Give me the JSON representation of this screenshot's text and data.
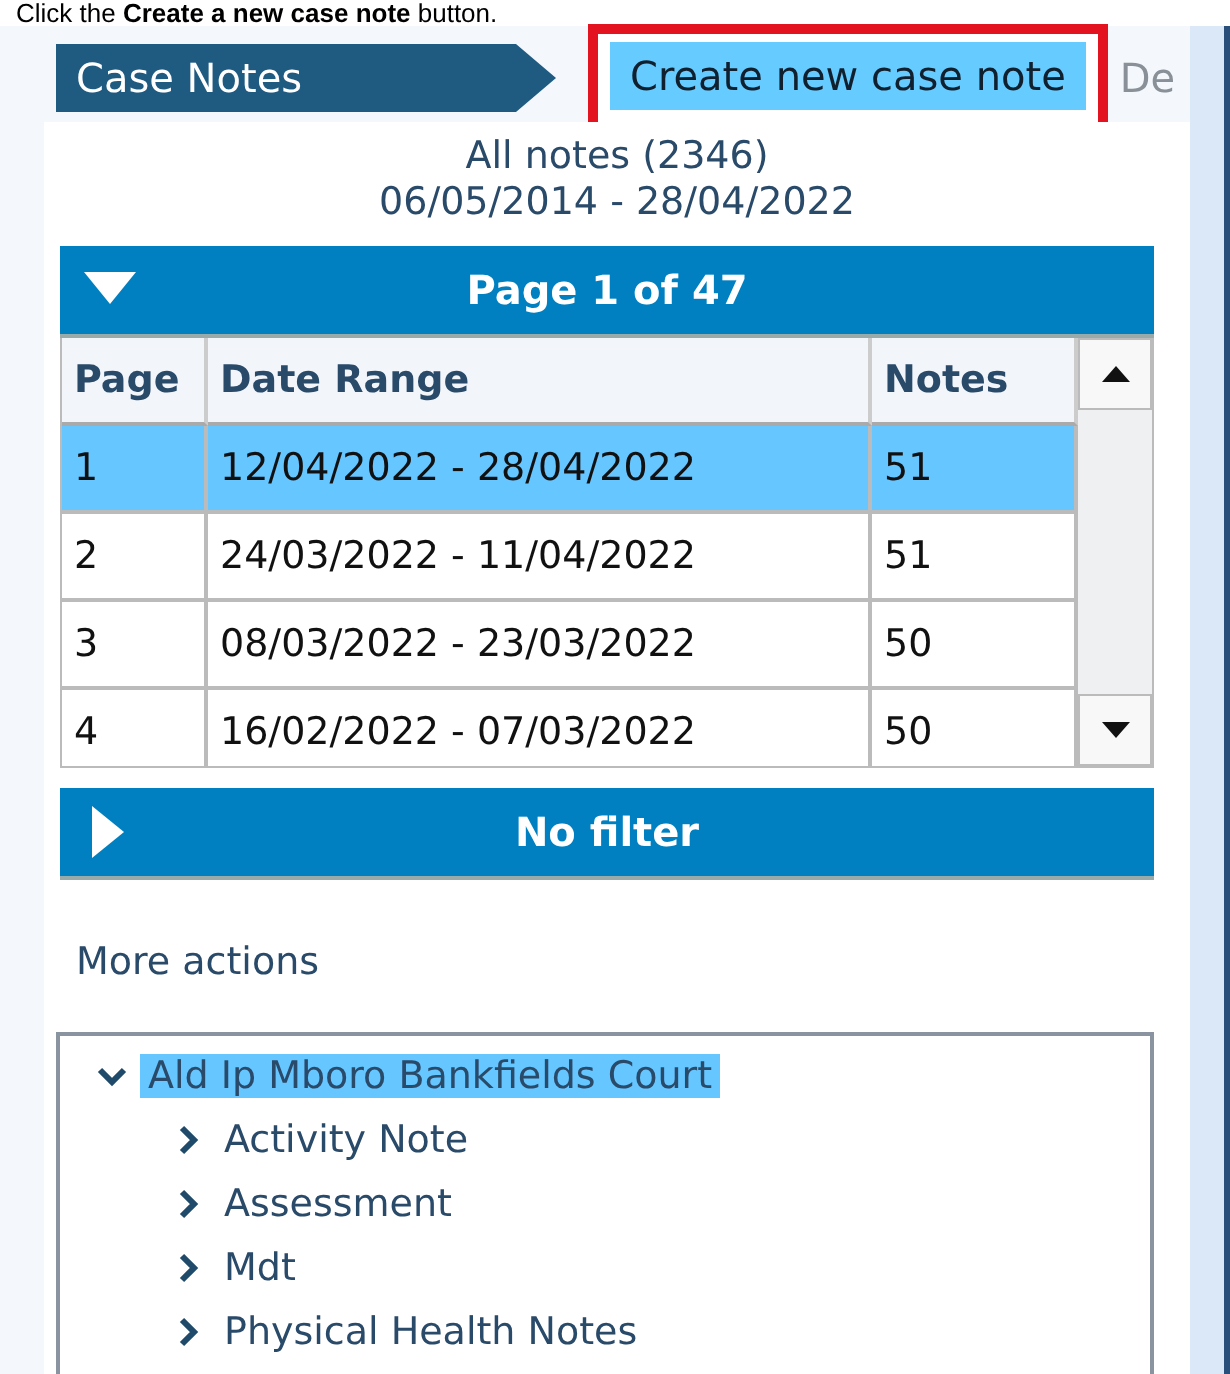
{
  "instruction": "Click the **Create a new case note** button.",
  "header": {
    "section_tab": "Case Notes",
    "create_button": {
      "label": "Create new case note",
      "highlighted": true
    },
    "next_tab": "De"
  },
  "summary": {
    "title": "All notes (2346)",
    "range": "06/05/2014 - 28/04/2022"
  },
  "pages_panel": {
    "title": "Page 1 of 47",
    "expanded": true,
    "table": {
      "columns": [
        "Page",
        "Date Range",
        "Notes"
      ],
      "rows": [
        {
          "cells": [
            "1",
            "12/04/2022 - 28/04/2022",
            "51"
          ],
          "selected": true
        },
        {
          "cells": [
            "2",
            "24/03/2022 - 11/04/2022",
            "51"
          ],
          "selected": false
        },
        {
          "cells": [
            "3",
            "08/03/2022 - 23/03/2022",
            "50"
          ],
          "selected": false
        },
        {
          "cells": [
            "4",
            "16/02/2022 - 07/03/2022",
            "50"
          ],
          "selected": false
        }
      ]
    }
  },
  "filter_panel": {
    "title": "No filter",
    "expanded": false
  },
  "more_actions": "More actions",
  "tree": [
    {
      "label": "Ald Ip Mboro Bankfields Court",
      "expanded": true,
      "selected": true,
      "children": [
        {
          "label": "Activity Note",
          "expanded": false,
          "selected": false
        },
        {
          "label": "Assessment",
          "expanded": false,
          "selected": false
        },
        {
          "label": "Mdt",
          "expanded": false,
          "selected": false
        },
        {
          "label": "Physical Health Notes",
          "expanded": false,
          "selected": false
        }
      ]
    }
  ]
}
